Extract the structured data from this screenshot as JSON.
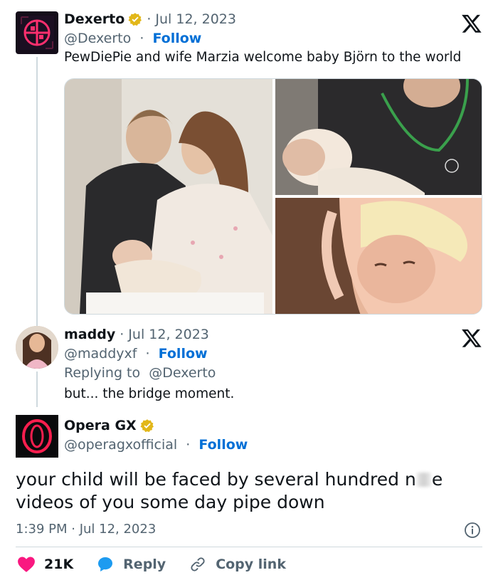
{
  "tweet1": {
    "display_name": "Dexerto",
    "date": "· Jul 12, 2023",
    "handle": "@Dexerto",
    "separator": "·",
    "follow_label": "Follow",
    "text": "PewDiePie and wife Marzia welcome baby Björn to the world",
    "verified_icon": "gold-verified-badge",
    "platform_icon": "x-logo-icon"
  },
  "tweet2": {
    "display_name": "maddy",
    "date": "· Jul 12, 2023",
    "handle": "@maddyxf",
    "separator": "·",
    "follow_label": "Follow",
    "replying_prefix": "Replying to",
    "replying_handle": "@Dexerto",
    "text": "but... the bridge moment.",
    "platform_icon": "x-logo-icon"
  },
  "tweet3": {
    "display_name": "Opera GX",
    "handle": "@operagxofficial",
    "separator": "·",
    "follow_label": "Follow",
    "text_line1_a": "your child will be faced by several hundred n",
    "text_line1_b": "e",
    "text_line2": "videos of you some day pipe down",
    "timestamp": "1:39 PM · Jul 12, 2023",
    "verified_icon": "gold-verified-badge",
    "info_icon": "info-icon"
  },
  "actions": {
    "likes": "21K",
    "reply_label": "Reply",
    "copy_label": "Copy link"
  },
  "colors": {
    "link_blue": "#006fd6",
    "like_red": "#f91880",
    "reply_blue": "#1d9bf0",
    "muted": "#536471",
    "verified_gold": "#e2b719"
  }
}
